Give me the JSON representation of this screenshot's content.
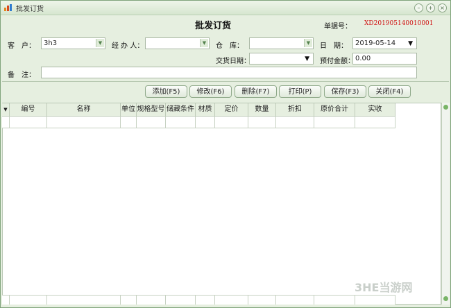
{
  "window": {
    "title": "批发订货",
    "app_icon": "chart-icon",
    "buttons": [
      "minimize-icon",
      "maximize-icon",
      "close-icon"
    ]
  },
  "header": {
    "page_title": "批发订货",
    "docno_label": "单据号：",
    "docno_value": "XD201905140010001"
  },
  "form": {
    "customer_label": "客　户：",
    "customer_value": "3h3",
    "handler_label": "经 办 人：",
    "handler_value": "",
    "warehouse_label": "仓　库：",
    "warehouse_value": "",
    "date_label": "日　期：",
    "date_value": "2019-05-14",
    "delivery_label": "交货日期：",
    "delivery_value": "",
    "prepay_label": "预付金额：",
    "prepay_value": "0.00",
    "remark_label": "备　注：",
    "remark_value": ""
  },
  "toolbar": {
    "add": "添加(F5)",
    "edit": "修改(F6)",
    "delete": "删除(F7)",
    "print": "打印(P)",
    "save": "保存(F3)",
    "close": "关闭(F4)"
  },
  "grid": {
    "columns": [
      "编号",
      "名称",
      "单位",
      "规格型号",
      "储藏条件",
      "材质",
      "定价",
      "数量",
      "折扣",
      "原价合计",
      "实收"
    ]
  },
  "watermark": "3HE当游网",
  "colors": {
    "window_bg": "#e6efe0",
    "docno": "#d01010",
    "accent_green": "#78b466"
  }
}
